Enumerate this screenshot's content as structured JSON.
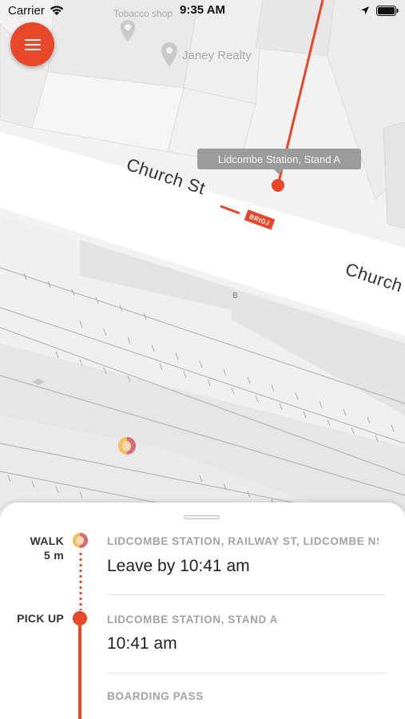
{
  "status_bar": {
    "carrier": "Carrier",
    "time": "9:35 AM"
  },
  "map": {
    "poi": [
      {
        "label": "Tobacco shop"
      },
      {
        "label": "Janey Realty"
      }
    ],
    "streets": [
      {
        "label": "Church St"
      },
      {
        "label": "Church"
      }
    ],
    "platform_letter": "B",
    "stop_tooltip": "Lidcombe Station, Stand A",
    "bus_sign": "BRIDJ",
    "route_color": "#e8472a"
  },
  "menu_button": {
    "icon": "hamburger-menu-icon"
  },
  "trip": {
    "steps": [
      {
        "kind": "WALK",
        "duration": "5 m",
        "title": "LIDCOMBE STATION, RAILWAY ST, LIDCOMBE NS...",
        "detail": "Leave by 10:41 am"
      },
      {
        "kind": "PICK UP",
        "title": "LIDCOMBE STATION, STAND A",
        "detail": "10:41 am"
      }
    ],
    "boarding_pass": "BOARDING PASS"
  }
}
